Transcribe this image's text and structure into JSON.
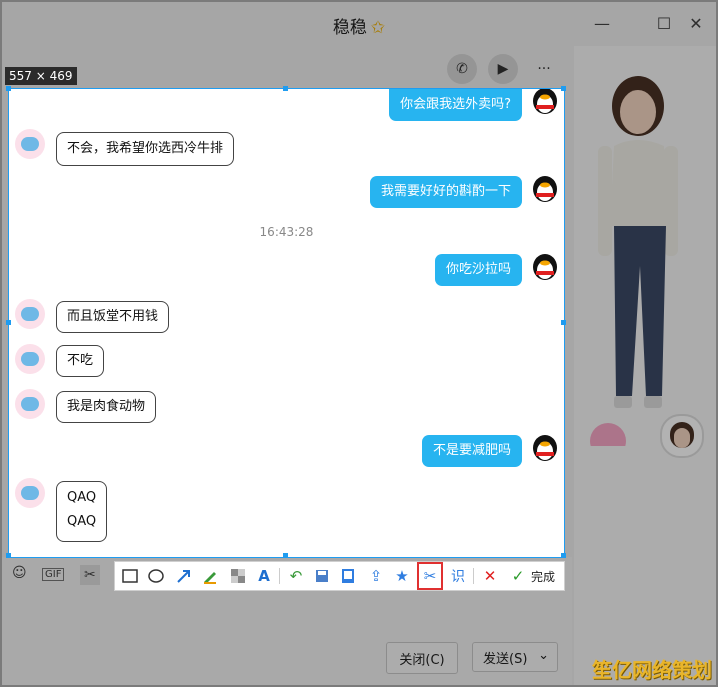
{
  "window": {
    "title": "稳稳",
    "star": "✩",
    "min": "—",
    "max": "☐",
    "close": "✕"
  },
  "top_icons": {
    "phone": "✆",
    "video": "▶",
    "more": "···"
  },
  "selection": {
    "size_label": "557 × 469"
  },
  "chat": {
    "time": "16:43:28",
    "messages": [
      {
        "side": "right",
        "text": "你会跟我选外卖吗?"
      },
      {
        "side": "left",
        "text": "不会，我希望你选西冷牛排"
      },
      {
        "side": "right",
        "text": "我需要好好的斟酌一下"
      },
      {
        "side": "right",
        "text": "你吃沙拉吗"
      },
      {
        "side": "left",
        "text": "而且饭堂不用钱"
      },
      {
        "side": "left",
        "text": "不吃"
      },
      {
        "side": "left",
        "text": "我是肉食动物"
      },
      {
        "side": "right",
        "text": "不是要减肥吗"
      },
      {
        "side": "left",
        "line1": "QAQ",
        "line2": "QAQ"
      }
    ]
  },
  "screenshot_toolbar": {
    "ocr": "识",
    "done": "完成"
  },
  "composer": {
    "emoji": "☺",
    "gif": "GIF",
    "scissors": "✂"
  },
  "buttons": {
    "close": "关闭(C)",
    "send": "发送(S)",
    "send_menu": "⌄"
  },
  "watermark": "笙亿网络策划"
}
